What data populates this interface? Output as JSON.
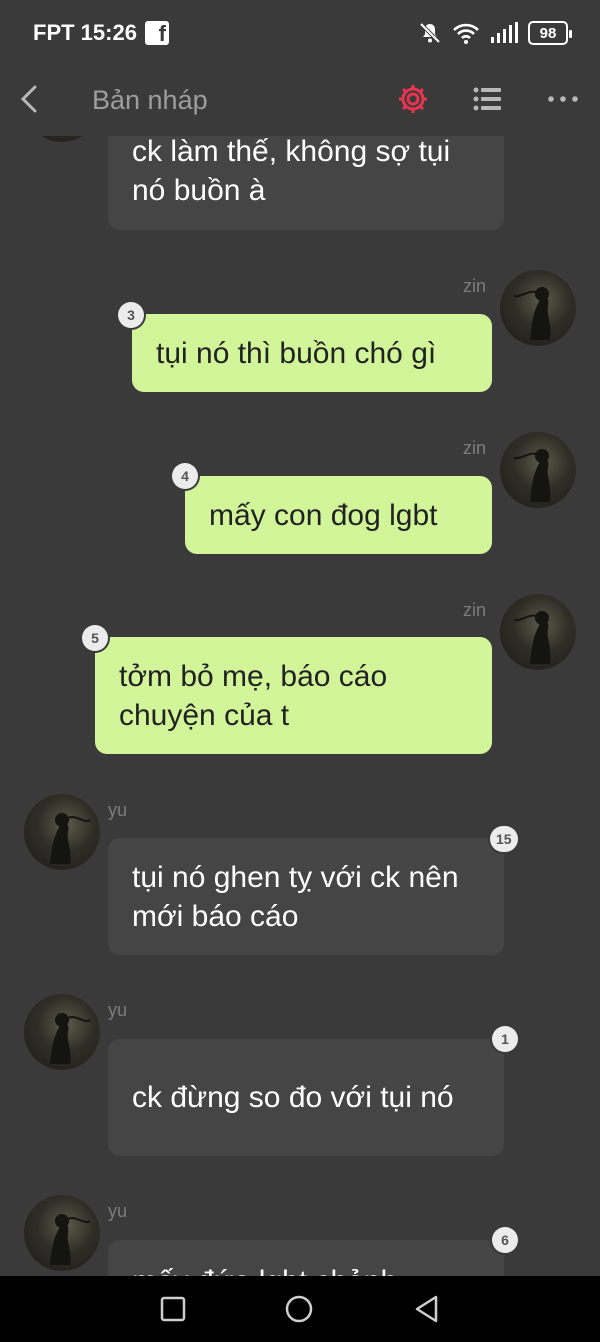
{
  "status_bar": {
    "carrier_time": "FPT 15:26",
    "battery": "98"
  },
  "app_bar": {
    "title": "Bản nháp"
  },
  "messages": [
    {
      "sender": "",
      "text": "ck làm thế, không sợ tụi nó buồn à",
      "count": ""
    },
    {
      "sender": "zin",
      "text": "tụi nó thì buồn chó gì",
      "count": "3"
    },
    {
      "sender": "zin",
      "text": "mấy con đog lgbt",
      "count": "4"
    },
    {
      "sender": "zin",
      "text": "tởm bỏ mẹ, báo cáo chuyện của t",
      "count": "5"
    },
    {
      "sender": "yu",
      "text": "tụi nó ghen tỵ với ck nên mới báo cáo",
      "count": "15"
    },
    {
      "sender": "yu",
      "text": "ck đừng so đo với tụi nó",
      "count": "1"
    },
    {
      "sender": "yu",
      "text": "mấy đứa lgbt chảnh",
      "count": "6"
    }
  ],
  "colors": {
    "accent_gear": "#e8344f",
    "my_bubble": "#d2f59a",
    "their_bubble": "#454546",
    "background": "#3a3a3b"
  },
  "icons": [
    "back-chevron",
    "gear",
    "list",
    "more-dots",
    "square",
    "circle",
    "triangle-back"
  ]
}
